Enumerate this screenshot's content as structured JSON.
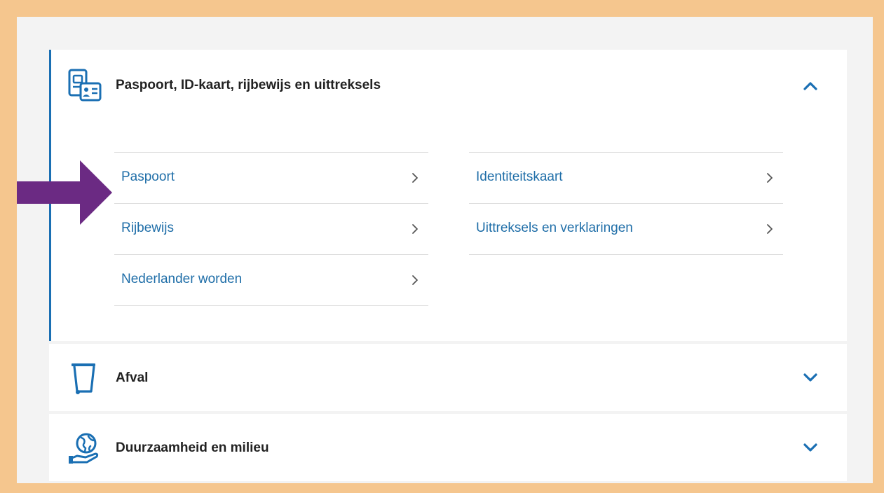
{
  "sections": [
    {
      "title": "Paspoort, ID-kaart, rijbewijs en uittreksels",
      "icon": "id-documents-icon",
      "expanded": true,
      "links": {
        "left": [
          "Paspoort",
          "Rijbewijs",
          "Nederlander worden"
        ],
        "right": [
          "Identiteitskaart",
          "Uittreksels en verklaringen"
        ]
      }
    },
    {
      "title": "Afval",
      "icon": "waste-bin-icon",
      "expanded": false
    },
    {
      "title": "Duurzaamheid en milieu",
      "icon": "globe-in-hand-icon",
      "expanded": false
    }
  ],
  "annotation": {
    "icon": "arrow-right-icon",
    "color": "#6b2a83",
    "points_to": "Paspoort"
  },
  "colors": {
    "link": "#1f6ea8",
    "icon": "#1a6fb3",
    "accent": "#1a6fb3",
    "frame": "#f5c68e",
    "panel": "#f3f3f3"
  }
}
